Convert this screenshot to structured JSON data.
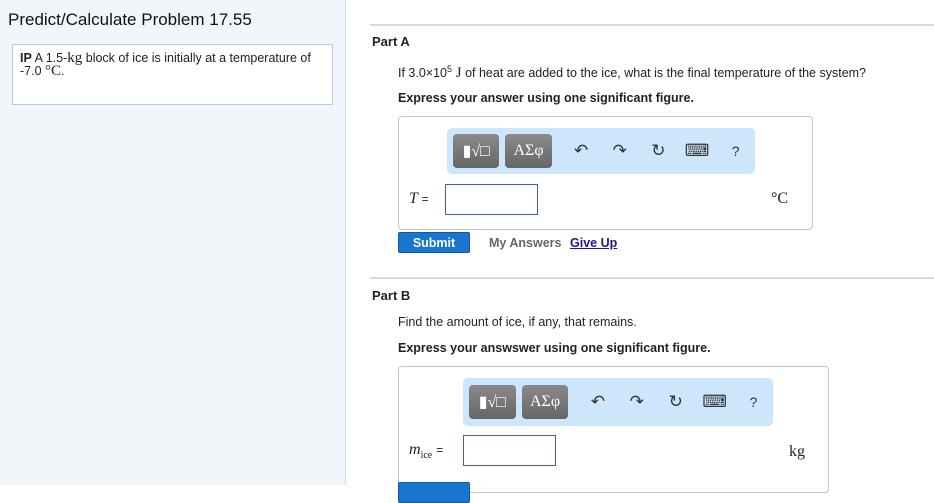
{
  "title": "Predict/Calculate Problem 17.55",
  "intro": {
    "prefix": "IP",
    "text1": " A 1.5-",
    "unit1": "kg",
    "text2": " block of ice is initially at a temperature of -7.0 ",
    "unit2": "°C",
    "end": "."
  },
  "toolbar": {
    "template": "▮√□",
    "greek": "ΑΣφ",
    "undo": "↶",
    "redo": "↷",
    "reset": "↻",
    "keyboard": "⌨",
    "help": "?"
  },
  "partA": {
    "label": "Part A",
    "q1": "If 3.0×10",
    "exp": "5",
    "q2": " J",
    "q3": " of heat are added to the ice, what is the final temperature of the system?",
    "instruction": "Express your answer using one significant figure.",
    "var": "T",
    "eq": "=",
    "unit": "°C",
    "value": "",
    "submit": "Submit",
    "my_answers": "My Answers",
    "give_up": "Give Up"
  },
  "partB": {
    "label": "Part B",
    "question": "Find the amount of ice, if any, that remains.",
    "instruction": "Express your answswer using one significant figure.",
    "var": "m",
    "sub": "ice",
    "eq": "=",
    "unit": "kg",
    "value": ""
  }
}
